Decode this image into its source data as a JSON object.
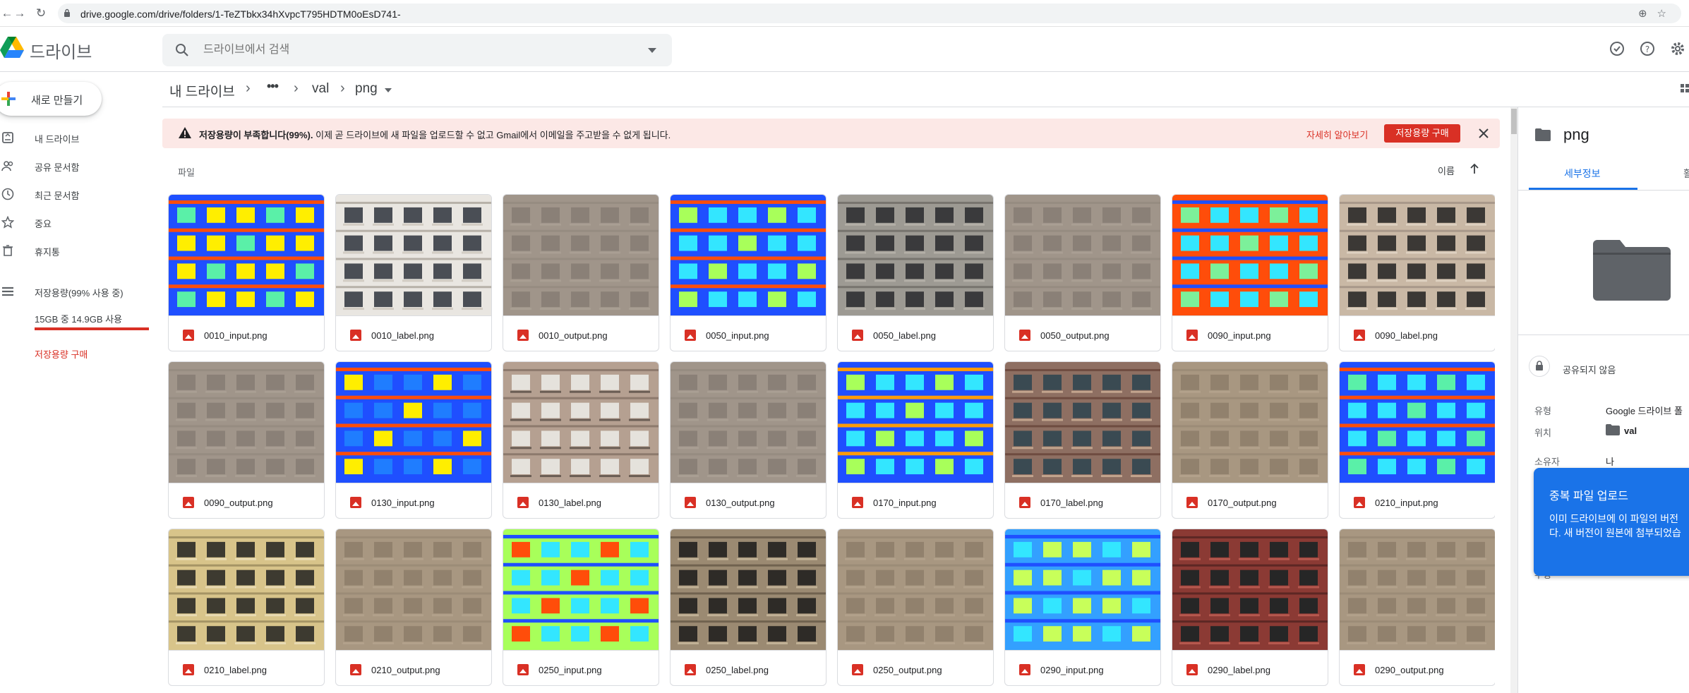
{
  "browser": {
    "url": "drive.google.com/drive/folders/1-TeZTbkx34hXvpcT795HDTM0oEsD741-"
  },
  "header": {
    "app_title": "드라이브",
    "search_placeholder": "드라이브에서 검색"
  },
  "sidebar": {
    "new_label": "새로 만들기",
    "items": [
      {
        "label": "내 드라이브",
        "icon": "my-drive-icon"
      },
      {
        "label": "공유 문서함",
        "icon": "shared-icon"
      },
      {
        "label": "최근 문서함",
        "icon": "clock-icon"
      },
      {
        "label": "중요",
        "icon": "star-icon"
      },
      {
        "label": "휴지통",
        "icon": "trash-icon"
      }
    ],
    "storage_label": "저장용량(99% 사용 중)",
    "storage_detail": "15GB 중 14.9GB 사용",
    "storage_used_fraction": 0.99,
    "buy_storage": "저장용량 구매"
  },
  "breadcrumb": {
    "root": "내 드라이브",
    "more": "•••",
    "parent": "val",
    "current": "png"
  },
  "alert": {
    "bold_text": "저장용량이 부족합니다(99%).",
    "text": " 이제 곧 드라이브에 새 파일을 업로드할 수 없고 Gmail에서 이메일을 주고받을 수 없게 됩니다.",
    "learn_more": "자세히 알아보기",
    "buy_button": "저장용량 구매"
  },
  "files_section": {
    "heading": "파일",
    "sort_label": "이름"
  },
  "files": [
    {
      "name": "0010_input.png",
      "kind": "label-blue"
    },
    {
      "name": "0010_label.png",
      "kind": "photo-white"
    },
    {
      "name": "0010_output.png",
      "kind": "blur-gray"
    },
    {
      "name": "0050_input.png",
      "kind": "label-busy"
    },
    {
      "name": "0050_label.png",
      "kind": "photo-gray"
    },
    {
      "name": "0050_output.png",
      "kind": "blur-gray"
    },
    {
      "name": "0090_input.png",
      "kind": "label-orange"
    },
    {
      "name": "0090_label.png",
      "kind": "photo-tan"
    },
    {
      "name": "0090_output.png",
      "kind": "blur-gray"
    },
    {
      "name": "0130_input.png",
      "kind": "label-yellow"
    },
    {
      "name": "0130_label.png",
      "kind": "photo-brown"
    },
    {
      "name": "0130_output.png",
      "kind": "blur-gray"
    },
    {
      "name": "0170_input.png",
      "kind": "label-green"
    },
    {
      "name": "0170_label.png",
      "kind": "photo-red"
    },
    {
      "name": "0170_output.png",
      "kind": "blur-tan"
    },
    {
      "name": "0210_input.png",
      "kind": "label-cyan"
    },
    {
      "name": "0210_label.png",
      "kind": "photo-yellow"
    },
    {
      "name": "0210_output.png",
      "kind": "blur-tan"
    },
    {
      "name": "0250_input.png",
      "kind": "label-lime"
    },
    {
      "name": "0250_label.png",
      "kind": "photo-ornate"
    },
    {
      "name": "0250_output.png",
      "kind": "blur-tan"
    },
    {
      "name": "0290_input.png",
      "kind": "label-stripes"
    },
    {
      "name": "0290_label.png",
      "kind": "photo-redbrick"
    },
    {
      "name": "0290_output.png",
      "kind": "blur-tan"
    }
  ],
  "details": {
    "title": "png",
    "tab_details": "세부정보",
    "tab_activity": "활",
    "share_status": "공유되지 않음",
    "properties": [
      {
        "key": "유형",
        "value": "Google 드라이브 폴"
      },
      {
        "key": "위치",
        "value": "val"
      },
      {
        "key": "소유자",
        "value": "나"
      }
    ],
    "extra_key": "수정"
  },
  "toast": {
    "title": "중복 파일 업로드",
    "body_line1": "이미 드라이브에 이 파일의 버전",
    "body_line2": "다. 새 버전이 원본에 첨부되었습"
  },
  "colors": {
    "accent": "#1a73e8",
    "danger": "#d93025",
    "alert_bg": "#fce8e6"
  }
}
